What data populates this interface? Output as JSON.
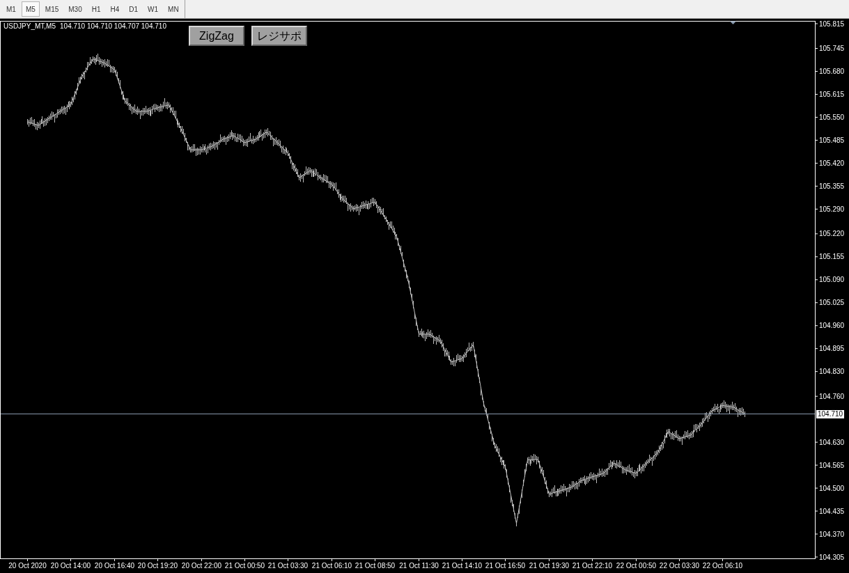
{
  "toolbar": {
    "timeframes": [
      {
        "label": "M1",
        "selected": false
      },
      {
        "label": "M5",
        "selected": true
      },
      {
        "label": "M15",
        "selected": false
      },
      {
        "label": "M30",
        "selected": false
      },
      {
        "label": "H1",
        "selected": false
      },
      {
        "label": "H4",
        "selected": false
      },
      {
        "label": "D1",
        "selected": false
      },
      {
        "label": "W1",
        "selected": false
      },
      {
        "label": "MN",
        "selected": false
      }
    ]
  },
  "chart": {
    "symbol": "USDJPY_MT,M5",
    "quotes": [
      "104.710",
      "104.710",
      "104.707",
      "104.710"
    ],
    "buttons": [
      {
        "label": "ZigZag"
      },
      {
        "label": "レジサポ"
      }
    ],
    "current_price": "104.710",
    "chart_data": {
      "type": "line",
      "ylim": [
        104.305,
        105.815
      ],
      "categories": [
        null,
        null,
        "20 Oct 2020",
        null,
        null,
        null,
        "20 Oct 14:00",
        null,
        null,
        null,
        "20 Oct 16:40",
        null,
        null,
        null,
        "20 Oct 19:20",
        null,
        null,
        null,
        "20 Oct 22:00",
        null,
        null,
        null,
        "21 Oct 00:50",
        null,
        null,
        null,
        "21 Oct 03:30",
        null,
        null,
        null,
        "21 Oct 06:10",
        null,
        null,
        null,
        "21 Oct 08:50",
        null,
        null,
        null,
        "21 Oct 11:30",
        null,
        null,
        null,
        "21 Oct 14:10",
        null,
        null,
        null,
        "21 Oct 16:50",
        null,
        null,
        null,
        "21 Oct 19:30",
        null,
        null,
        null,
        "21 Oct 22:10",
        null,
        null,
        null,
        "22 Oct 00:50",
        null,
        null,
        null,
        "22 Oct 03:30",
        null,
        null,
        null,
        "22 Oct 06:10",
        null,
        null,
        null,
        null,
        null,
        null,
        null,
        null
      ],
      "series": [
        {
          "color": "#c0c0c0",
          "values": [
            null,
            null,
            105.537,
            105.527,
            105.547,
            105.567,
            105.586,
            105.665,
            105.715,
            105.705,
            105.685,
            105.596,
            105.567,
            105.567,
            105.577,
            105.585,
            105.527,
            105.458,
            105.458,
            105.468,
            105.488,
            105.498,
            105.478,
            105.488,
            105.508,
            105.478,
            105.448,
            105.379,
            105.399,
            105.379,
            105.36,
            105.32,
            105.291,
            105.301,
            105.31,
            105.261,
            105.212,
            105.094,
            104.936,
            104.936,
            104.916,
            104.857,
            104.867,
            104.906,
            104.739,
            104.62,
            104.56,
            104.4,
            104.58,
            104.581,
            104.483,
            104.492,
            104.502,
            104.522,
            104.532,
            104.542,
            104.571,
            104.552,
            104.542,
            104.571,
            104.601,
            104.66,
            104.64,
            104.65,
            104.68,
            104.719,
            104.734,
            104.729,
            104.71,
            null,
            null,
            null,
            null,
            null,
            null
          ]
        }
      ],
      "yticks": [
        {
          "value": 105.815,
          "label": "105.815"
        },
        {
          "value": 105.745,
          "label": "105.745"
        },
        {
          "value": 105.68,
          "label": "105.680"
        },
        {
          "value": 105.615,
          "label": "105.615"
        },
        {
          "value": 105.55,
          "label": "105.550"
        },
        {
          "value": 105.485,
          "label": "105.485"
        },
        {
          "value": 105.42,
          "label": "105.420"
        },
        {
          "value": 105.355,
          "label": "105.355"
        },
        {
          "value": 105.29,
          "label": "105.290"
        },
        {
          "value": 105.22,
          "label": "105.220"
        },
        {
          "value": 105.155,
          "label": "105.155"
        },
        {
          "value": 105.09,
          "label": "105.090"
        },
        {
          "value": 105.025,
          "label": "105.025"
        },
        {
          "value": 104.96,
          "label": "104.960"
        },
        {
          "value": 104.895,
          "label": "104.895"
        },
        {
          "value": 104.83,
          "label": "104.830"
        },
        {
          "value": 104.76,
          "label": "104.760"
        },
        {
          "value": 104.63,
          "label": "104.630"
        },
        {
          "value": 104.565,
          "label": "104.565"
        },
        {
          "value": 104.5,
          "label": "104.500"
        },
        {
          "value": 104.435,
          "label": "104.435"
        },
        {
          "value": 104.37,
          "label": "104.370"
        },
        {
          "value": 104.305,
          "label": "104.305"
        }
      ]
    }
  }
}
